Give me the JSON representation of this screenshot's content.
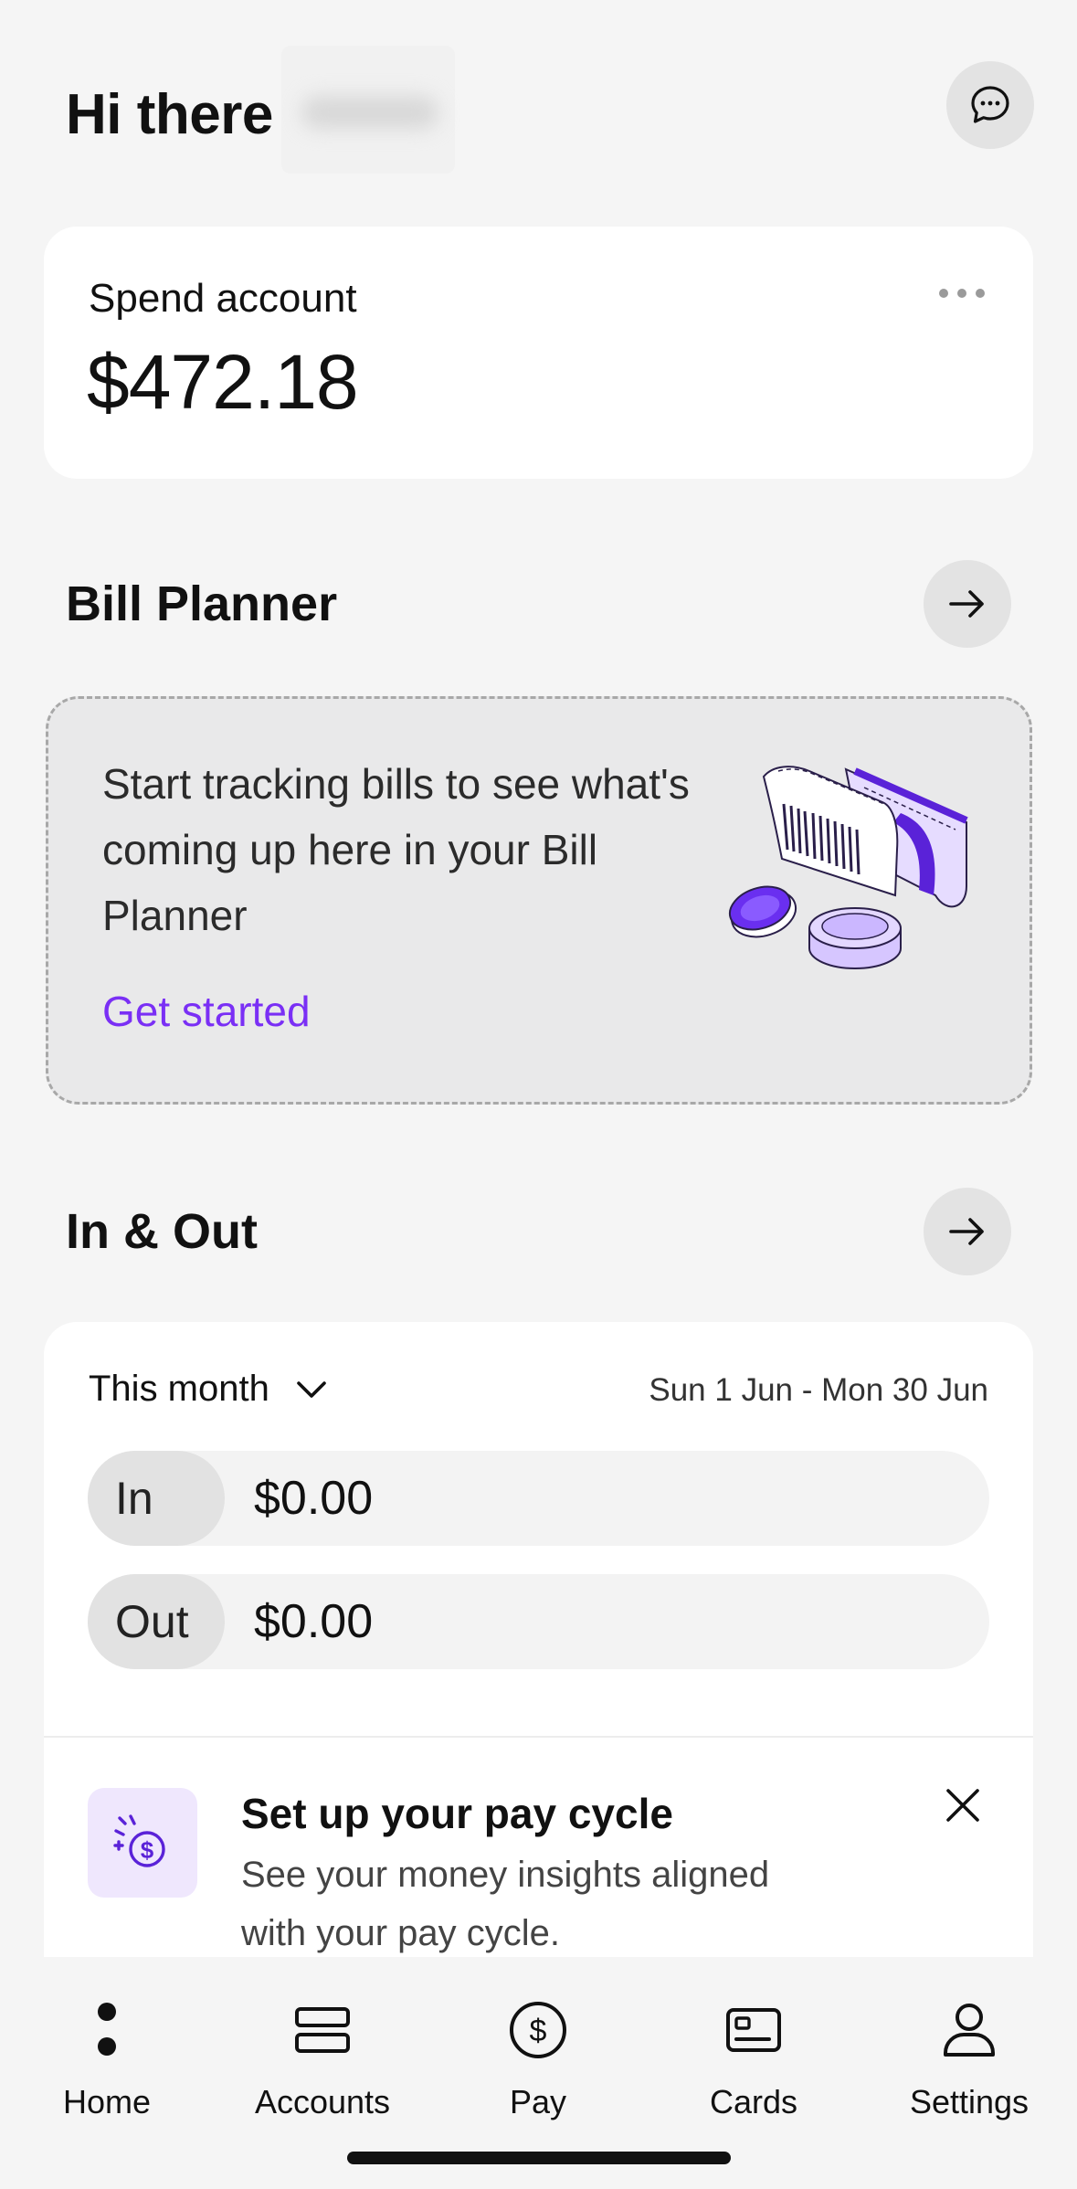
{
  "header": {
    "greeting": "Hi there",
    "chat_icon": "chat-bubble-icon"
  },
  "spend_account": {
    "label": "Spend account",
    "balance": "$472.18",
    "more_icon": "more-horizontal-icon"
  },
  "bill_planner": {
    "title": "Bill Planner",
    "empty_message": "Start tracking bills to see what's coming up here in your Bill Planner",
    "cta": "Get started",
    "illustration": "bill-and-coins-illustration"
  },
  "in_out": {
    "title": "In & Out",
    "period_selected": "This month",
    "date_range": "Sun 1 Jun - Mon 30 Jun",
    "rows": [
      {
        "label": "In",
        "value": "$0.00"
      },
      {
        "label": "Out",
        "value": "$0.00"
      }
    ]
  },
  "pay_cycle_prompt": {
    "title": "Set up your pay cycle",
    "description": "See your money insights aligned with your pay cycle.",
    "icon": "dollar-sparkle-icon"
  },
  "nav": {
    "items": [
      {
        "label": "Home",
        "icon": "home-dot-icon"
      },
      {
        "label": "Accounts",
        "icon": "accounts-icon"
      },
      {
        "label": "Pay",
        "icon": "dollar-circle-icon"
      },
      {
        "label": "Cards",
        "icon": "card-icon"
      },
      {
        "label": "Settings",
        "icon": "person-icon"
      }
    ]
  },
  "colors": {
    "accent": "#7a2ff5",
    "background": "#f5f5f5",
    "card": "#ffffff"
  }
}
